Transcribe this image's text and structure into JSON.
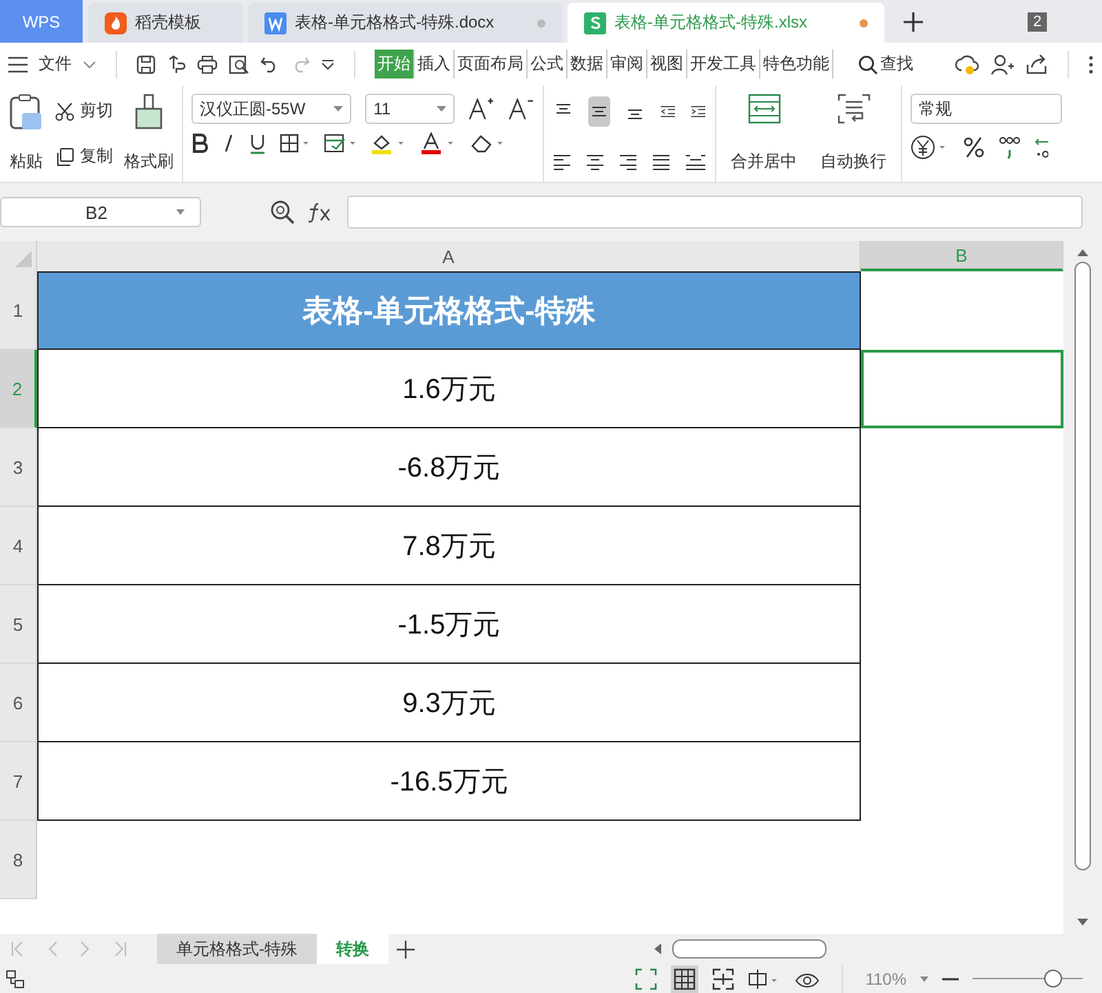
{
  "tabs": [
    {
      "kind": "home",
      "label": "WPS",
      "selected": false
    },
    {
      "kind": "template",
      "label": "稻壳模板",
      "selected": false
    },
    {
      "kind": "doc",
      "label": "表格-单元格格式-特殊.docx",
      "selected": false,
      "modified": false
    },
    {
      "kind": "sheet",
      "label": "表格-单元格格式-特殊.xlsx",
      "selected": true,
      "modified": true
    }
  ],
  "window_count": "2",
  "menu": {
    "file": "文件",
    "items": [
      {
        "label": "开始",
        "selected": true
      },
      {
        "label": "插入",
        "selected": false
      },
      {
        "label": "页面布局",
        "selected": false
      },
      {
        "label": "公式",
        "selected": false
      },
      {
        "label": "数据",
        "selected": false
      },
      {
        "label": "审阅",
        "selected": false
      },
      {
        "label": "视图",
        "selected": false
      },
      {
        "label": "开发工具",
        "selected": false
      },
      {
        "label": "特色功能",
        "selected": false
      }
    ],
    "search": "查找"
  },
  "toolbar": {
    "paste": "粘贴",
    "cut": "剪切",
    "copy": "复制",
    "format_painter": "格式刷",
    "font": "汉仪正圆-55W",
    "size": "11",
    "merge": "合并居中",
    "wrap": "自动换行",
    "number_format": "常规",
    "vertical_align": [
      {
        "selected": false
      },
      {
        "selected": true
      },
      {
        "selected": false
      }
    ]
  },
  "formula_bar": {
    "cell_ref": "B2"
  },
  "columns": [
    {
      "label": "A",
      "selected": false
    },
    {
      "label": "B",
      "selected": true
    }
  ],
  "rows": [
    {
      "number": "1",
      "selected": false,
      "cell": {
        "kind": "header",
        "text": "表格-单元格格式-特殊"
      }
    },
    {
      "number": "2",
      "selected": true,
      "cell": {
        "kind": "value",
        "text": "1.6万元"
      }
    },
    {
      "number": "3",
      "selected": false,
      "cell": {
        "kind": "value",
        "text": "-6.8万元"
      }
    },
    {
      "number": "4",
      "selected": false,
      "cell": {
        "kind": "value",
        "text": "7.8万元"
      }
    },
    {
      "number": "5",
      "selected": false,
      "cell": {
        "kind": "value",
        "text": "-1.5万元"
      }
    },
    {
      "number": "6",
      "selected": false,
      "cell": {
        "kind": "value",
        "text": "9.3万元"
      }
    },
    {
      "number": "7",
      "selected": false,
      "cell": {
        "kind": "value",
        "text": "-16.5万元"
      }
    },
    {
      "number": "8",
      "selected": false
    }
  ],
  "sheets": [
    {
      "label": "单元格格式-特殊",
      "selected": false
    },
    {
      "label": "转换",
      "selected": true
    }
  ],
  "zoom": "110%",
  "zoom_slider": {
    "level": 0.75
  }
}
